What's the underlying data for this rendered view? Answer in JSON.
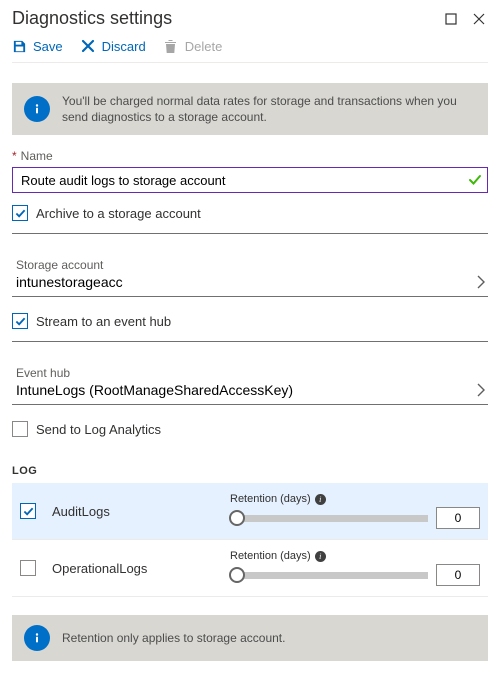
{
  "header": {
    "title": "Diagnostics settings"
  },
  "toolbar": {
    "save_label": "Save",
    "discard_label": "Discard",
    "delete_label": "Delete"
  },
  "info_top": "You'll be charged normal data rates for storage and transactions when you send diagnostics to a storage account.",
  "name_field": {
    "label": "Name",
    "value": "Route audit logs to storage account"
  },
  "archive_checkbox": {
    "label": "Archive to a storage account"
  },
  "storage_selector": {
    "label": "Storage account",
    "value": "intunestorageacc"
  },
  "stream_checkbox": {
    "label": "Stream to an event hub"
  },
  "eventhub_selector": {
    "label": "Event hub",
    "value": "IntuneLogs (RootManageSharedAccessKey)"
  },
  "log_analytics_checkbox": {
    "label": "Send to Log Analytics"
  },
  "log_section": {
    "heading": "LOG",
    "retention_label": "Retention (days)",
    "rows": [
      {
        "name": "AuditLogs",
        "retention": "0"
      },
      {
        "name": "OperationalLogs",
        "retention": "0"
      }
    ]
  },
  "info_bottom": "Retention only applies to storage account."
}
